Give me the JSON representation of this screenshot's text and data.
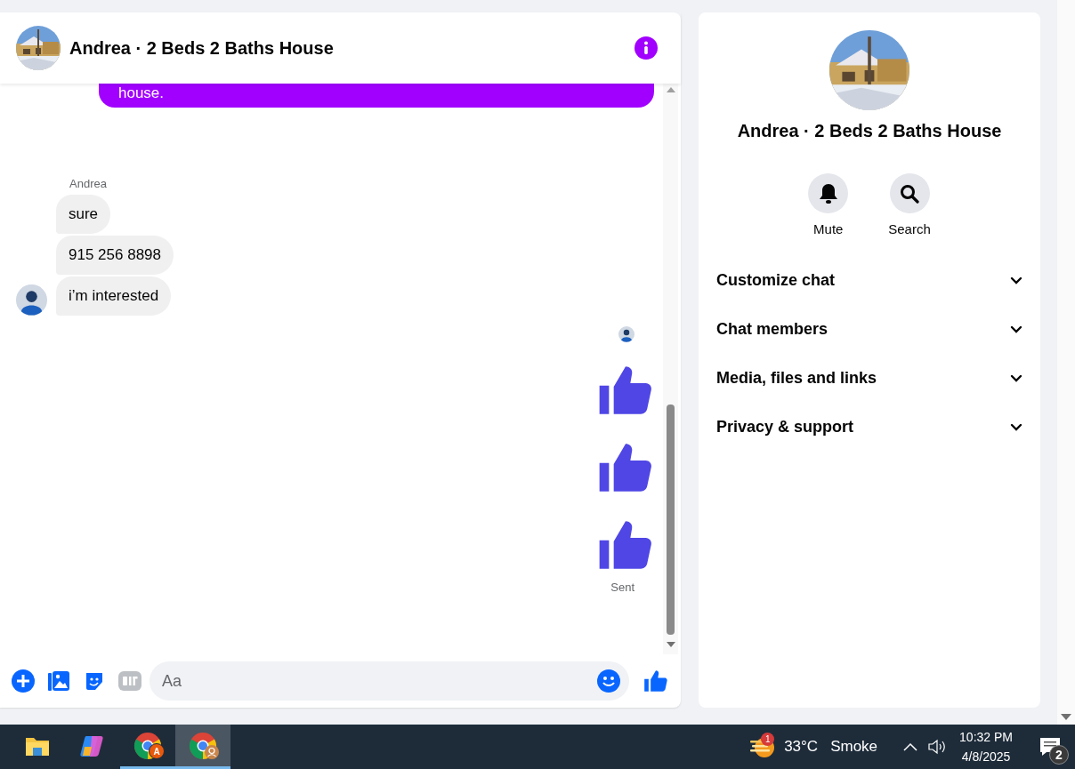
{
  "chat": {
    "title": "Andrea · 2 Beds 2 Baths House",
    "messages": [
      {
        "kind": "outgoing",
        "text": "house."
      },
      {
        "kind": "sender",
        "text": "Andrea"
      },
      {
        "kind": "incoming",
        "text": "sure"
      },
      {
        "kind": "incoming",
        "text": "915 256 8898"
      },
      {
        "kind": "incoming",
        "text": "i’m interested"
      },
      {
        "kind": "seen"
      },
      {
        "kind": "like"
      },
      {
        "kind": "like"
      },
      {
        "kind": "like"
      },
      {
        "kind": "status",
        "text": "Sent"
      }
    ],
    "composer": {
      "placeholder": "Aa"
    }
  },
  "details": {
    "title": "Andrea · 2 Beds 2 Baths House",
    "actions": [
      {
        "kind": "bell",
        "label": "Mute"
      },
      {
        "kind": "search",
        "label": "Search"
      }
    ],
    "sections": [
      {
        "label": "Customize chat",
        "expanded": false
      },
      {
        "label": "Chat members",
        "expanded": false
      },
      {
        "label": "Media, files and links",
        "expanded": false
      },
      {
        "label": "Privacy & support",
        "expanded": false
      }
    ]
  },
  "taskbar": {
    "apps": [
      {
        "kind": "folder",
        "running": false,
        "selected": false
      },
      {
        "kind": "copilot",
        "running": false,
        "selected": false
      },
      {
        "kind": "chrome",
        "badge": "A",
        "running": true,
        "selected": false
      },
      {
        "kind": "chrome",
        "running": true,
        "selected": true
      }
    ],
    "weather": {
      "badge": "1",
      "temperature": "33°C",
      "condition": "Smoke"
    },
    "time": "10:32 PM",
    "date": "4/8/2025",
    "notifications": "2"
  }
}
